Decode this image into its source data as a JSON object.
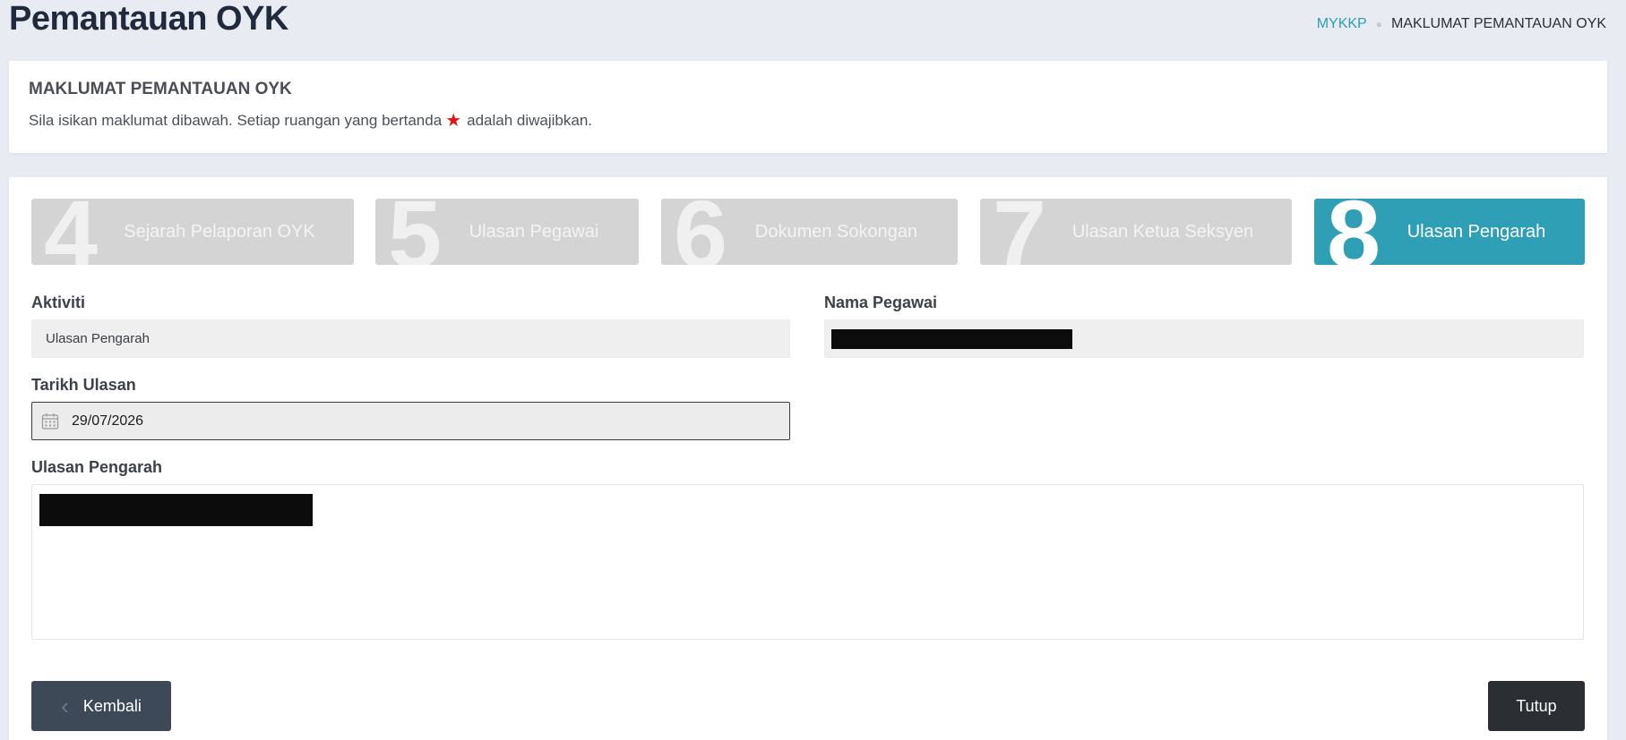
{
  "page": {
    "title": "Pemantauan OYK"
  },
  "breadcrumb": {
    "home": "MYKKP",
    "separator": "●",
    "current": "MAKLUMAT PEMANTAUAN OYK"
  },
  "info_card": {
    "title": "MAKLUMAT PEMANTAUAN OYK",
    "desc_before": "Sila isikan maklumat dibawah. Setiap ruangan yang bertanda",
    "star": "★",
    "desc_after": "adalah diwajibkan."
  },
  "steps": [
    {
      "number": "4",
      "label": "Sejarah Pelaporan OYK",
      "active": false
    },
    {
      "number": "5",
      "label": "Ulasan Pegawai",
      "active": false
    },
    {
      "number": "6",
      "label": "Dokumen Sokongan",
      "active": false
    },
    {
      "number": "7",
      "label": "Ulasan Ketua Seksyen",
      "active": false
    },
    {
      "number": "8",
      "label": "Ulasan Pengarah",
      "active": true
    }
  ],
  "form": {
    "aktiviti_label": "Aktiviti",
    "aktiviti_value": "Ulasan Pengarah",
    "nama_pegawai_label": "Nama Pegawai",
    "tarikh_label": "Tarikh Ulasan",
    "tarikh_value": "29/07/2026",
    "ulasan_label": "Ulasan Pengarah"
  },
  "buttons": {
    "back": "Kembali",
    "back_icon": "‹",
    "close": "Tutup"
  },
  "colors": {
    "accent": "#2e9fb4",
    "inactive_step": "#d4d4d4",
    "background": "#e9ebf3",
    "required": "#e01414"
  }
}
